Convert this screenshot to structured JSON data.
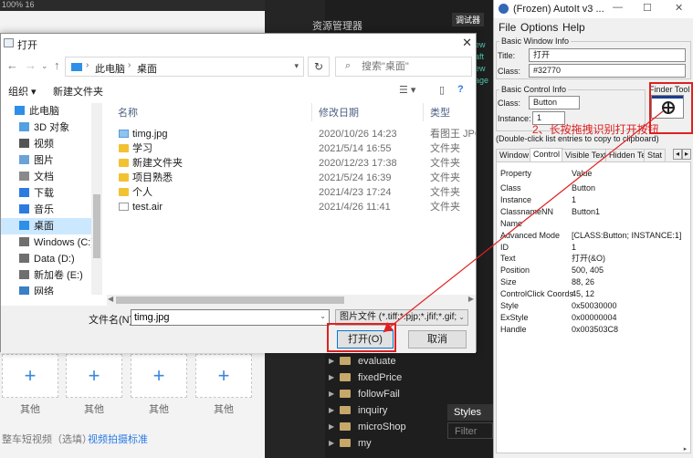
{
  "background_app": {
    "topbar_zoom": "100% 16",
    "upload_label": "其他",
    "desc_text": "整车短视频（选填）",
    "desc_link": "视频拍摄标准"
  },
  "editor": {
    "explorer_title": "资源管理器",
    "vscode_tab": "调试器",
    "tree_items": [
      "evaluate",
      "fixedPrice",
      "followFail",
      "inquiry",
      "microShop",
      "my"
    ],
    "styles_tab": "Styles",
    "filter_label": "Filter",
    "code_fragments": [
      "ew",
      "aft",
      "ew",
      "age"
    ]
  },
  "dialog": {
    "title": "打开",
    "breadcrumb": [
      "此电脑",
      "桌面"
    ],
    "search_placeholder": "搜索\"桌面\"",
    "toolbar": {
      "organize": "组织 ▾",
      "new_folder": "新建文件夹"
    },
    "nav_items": [
      {
        "label": "此电脑",
        "icon": "pc-icon"
      },
      {
        "label": "3D 对象",
        "icon": "cube-icon"
      },
      {
        "label": "视频",
        "icon": "video-icon"
      },
      {
        "label": "图片",
        "icon": "picture-icon"
      },
      {
        "label": "文档",
        "icon": "document-icon"
      },
      {
        "label": "下载",
        "icon": "download-icon"
      },
      {
        "label": "音乐",
        "icon": "music-icon"
      },
      {
        "label": "桌面",
        "icon": "desktop-icon",
        "selected": true
      },
      {
        "label": "Windows (C:)",
        "icon": "drive-icon"
      },
      {
        "label": "Data (D:)",
        "icon": "drive-icon"
      },
      {
        "label": "新加卷 (E:)",
        "icon": "drive-icon"
      },
      {
        "label": "网络",
        "icon": "network-icon"
      }
    ],
    "columns": {
      "name": "名称",
      "date": "修改日期",
      "type": "类型"
    },
    "files": [
      {
        "name": "timg.jpg",
        "date": "2020/10/26 14:23",
        "type": "看图王 JPG 图",
        "kind": "jpg"
      },
      {
        "name": "学习",
        "date": "2021/5/14 16:55",
        "type": "文件夹",
        "kind": "folder"
      },
      {
        "name": "新建文件夹",
        "date": "2020/12/23 17:38",
        "type": "文件夹",
        "kind": "folder"
      },
      {
        "name": "项目熟悉",
        "date": "2021/5/24 16:39",
        "type": "文件夹",
        "kind": "folder"
      },
      {
        "name": "个人",
        "date": "2021/4/23 17:24",
        "type": "文件夹",
        "kind": "folder"
      },
      {
        "name": "test.air",
        "date": "2021/4/26 11:41",
        "type": "文件夹",
        "kind": "air"
      }
    ],
    "filename_label": "文件名(N):",
    "filename_value": "timg.jpg",
    "filter_value": "图片文件 (*.tiff;*.pjp;*.jfif;*.gif;*",
    "open_button": "打开(O)",
    "cancel_button": "取消"
  },
  "autoit": {
    "title": "(Frozen) AutoIt v3 ...",
    "menu": [
      "File",
      "Options",
      "Help"
    ],
    "basic_window_group": "Basic Window Info",
    "title_label": "Title:",
    "title_value": "打开",
    "class_label": "Class:",
    "class_value": "#32770",
    "basic_control_group": "Basic Control Info",
    "finder_tool_label": "Finder Tool",
    "control_class_label": "Class:",
    "control_class_value": "Button",
    "instance_label": "Instance:",
    "instance_value": "1",
    "hint": "(Double-click list entries to copy to clipboard)",
    "tabs": [
      "Window",
      "Control",
      "Visible Text",
      "Hidden Text",
      "Stat"
    ],
    "active_tab": "Control",
    "list_header": {
      "property": "Property",
      "value": "Value"
    },
    "properties": [
      {
        "k": "Class",
        "v": "Button"
      },
      {
        "k": "Instance",
        "v": "1"
      },
      {
        "k": "ClassnameNN",
        "v": "Button1"
      },
      {
        "k": "Name",
        "v": ""
      },
      {
        "k": "Advanced Mode",
        "v": "[CLASS:Button; INSTANCE:1]"
      },
      {
        "k": "ID",
        "v": "1"
      },
      {
        "k": "Text",
        "v": "打开(&O)"
      },
      {
        "k": "Position",
        "v": "500, 405"
      },
      {
        "k": "Size",
        "v": "88, 26"
      },
      {
        "k": "ControlClick Coords",
        "v": "45, 12"
      },
      {
        "k": "Style",
        "v": "0x50030000"
      },
      {
        "k": "ExStyle",
        "v": "0x00000004"
      },
      {
        "k": "Handle",
        "v": "0x003503C8"
      }
    ]
  },
  "annotation": {
    "text": "2、长按拖拽识别打开按钮",
    "color": "#e02020"
  }
}
